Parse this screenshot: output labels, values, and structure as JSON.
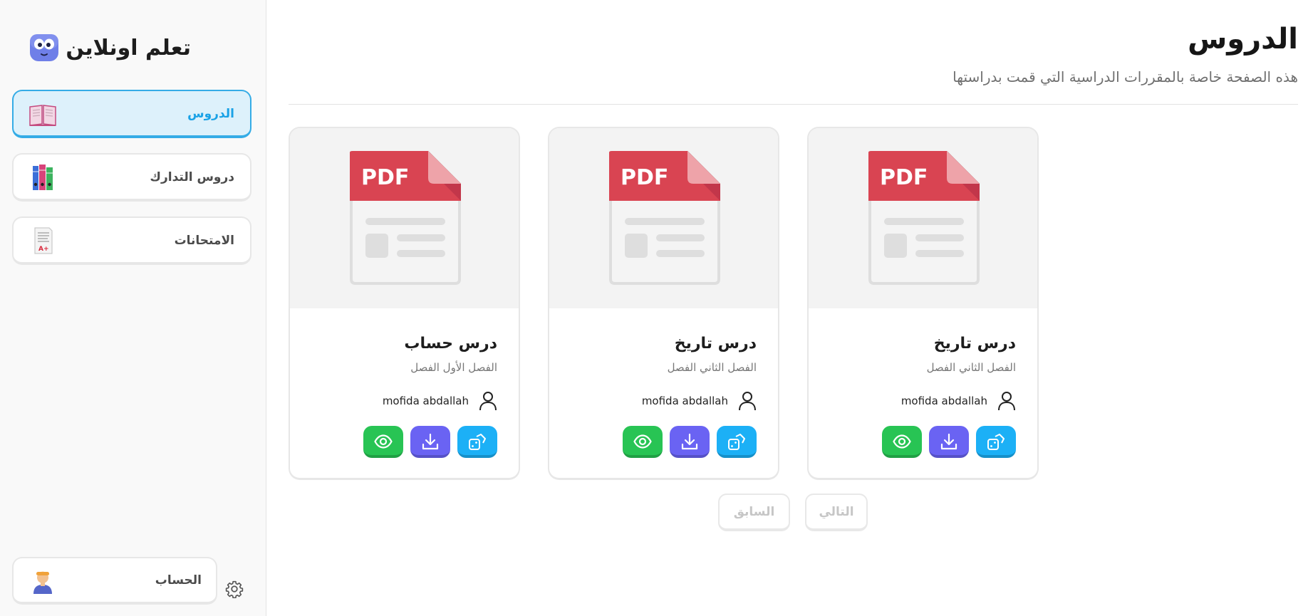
{
  "brand": {
    "title": "تعلم اونلاين"
  },
  "sidebar": {
    "items": [
      {
        "label": "الدروس",
        "icon": "book-icon",
        "active": true
      },
      {
        "label": "دروس التدارك",
        "icon": "binders-icon",
        "active": false
      },
      {
        "label": "الامتحانات",
        "icon": "exam-paper-icon",
        "active": false
      }
    ],
    "account": {
      "label": "الحساب",
      "icon": "user-avatar-icon"
    },
    "settings_icon": "gear-icon"
  },
  "main": {
    "title": "الدروس",
    "subtitle": "هذه الصفحة خاصة بالمقررات الدراسية التي قمت بدراستها"
  },
  "cards": [
    {
      "pdf_label": "PDF",
      "title": "درس تاريخ",
      "semester": "الفصل الثاني الفصل",
      "author": "mofida abdallah"
    },
    {
      "pdf_label": "PDF",
      "title": "درس تاريخ",
      "semester": "الفصل الثاني الفصل",
      "author": "mofida abdallah"
    },
    {
      "pdf_label": "PDF",
      "title": "درس حساب",
      "semester": "الفصل الأول الفصل",
      "author": "mofida abdallah"
    }
  ],
  "card_actions": {
    "share_icon": "share-icon",
    "download_icon": "download-icon",
    "view_icon": "eye-icon"
  },
  "pagination": {
    "next": "التالي",
    "prev": "السابق"
  },
  "colors": {
    "accent": "#1aa2e6",
    "active_bg": "#ddf1fb",
    "share": "#1cb0f6",
    "download": "#6a63f3",
    "view": "#28c454",
    "pdf_red": "#d94452"
  }
}
